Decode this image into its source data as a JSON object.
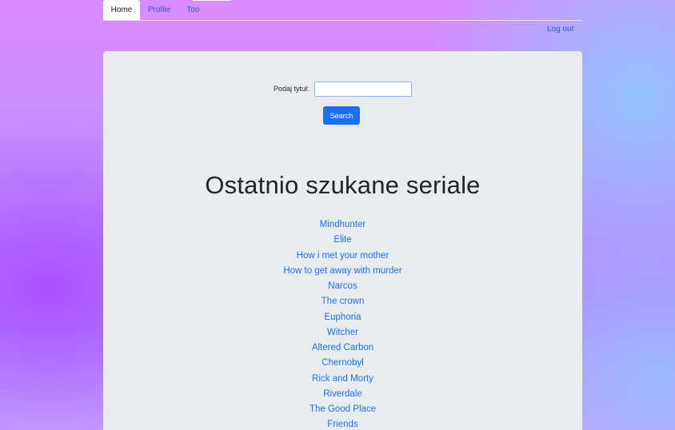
{
  "nav": {
    "tabs": [
      {
        "label": "Home",
        "active": true
      },
      {
        "label": "Profile",
        "active": false
      },
      {
        "label": "Too",
        "active": false
      }
    ],
    "logout_label": "Log out"
  },
  "search": {
    "label": "Podaj tytuł:",
    "value": "",
    "placeholder": "",
    "button_label": "Search"
  },
  "recent": {
    "heading": "Ostatnio szukane seriale",
    "items": [
      "Mindhunter",
      "Elite",
      "How i met your mother",
      "How to get away with murder",
      "Narcos",
      "The crown",
      "Euphoria",
      "Witcher",
      "Altered Carbon",
      "Chernobyl",
      "Rick and Morty",
      "Riverdale",
      "The Good Place",
      "Friends"
    ]
  },
  "colors": {
    "accent": "#1a6ff3",
    "link": "#2b59e0",
    "panel": "#e9ecef"
  }
}
